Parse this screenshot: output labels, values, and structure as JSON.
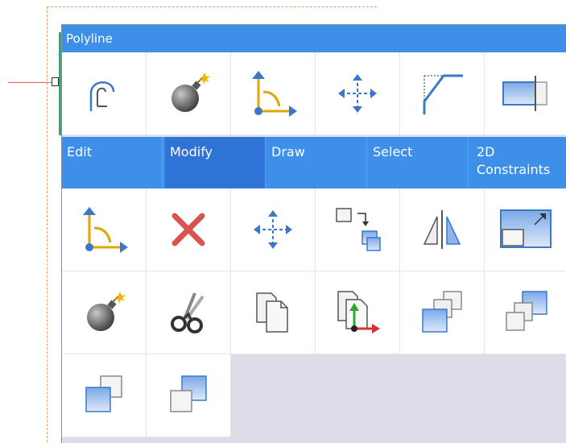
{
  "panel": {
    "title": "Polyline"
  },
  "tabs": [
    {
      "label": "Edit",
      "active": false
    },
    {
      "label": "Modify",
      "active": true
    },
    {
      "label": "Draw",
      "active": false
    },
    {
      "label": "Select",
      "active": false
    },
    {
      "label": "2D Constraints",
      "active": false
    }
  ],
  "colors": {
    "accent": "#3d8fe8",
    "active_tab": "#2f73d6",
    "delete_red": "#d9534f",
    "selection_green": "#1fb36b"
  },
  "top_tools": [
    "polyline-edit-icon",
    "explode-icon",
    "modify-vertex-icon",
    "move-icon",
    "fillet-icon",
    "stretch-icon"
  ],
  "modify_tools": [
    "modify-vertex-icon",
    "delete-icon",
    "move-icon",
    "copy-to-icon",
    "mirror-icon",
    "scale-icon",
    "explode-icon",
    "cut-icon",
    "copy-icon",
    "copy-with-basepoint-icon",
    "bring-to-front-icon",
    "send-to-back-icon",
    "bring-above-icon",
    "send-under-icon"
  ]
}
